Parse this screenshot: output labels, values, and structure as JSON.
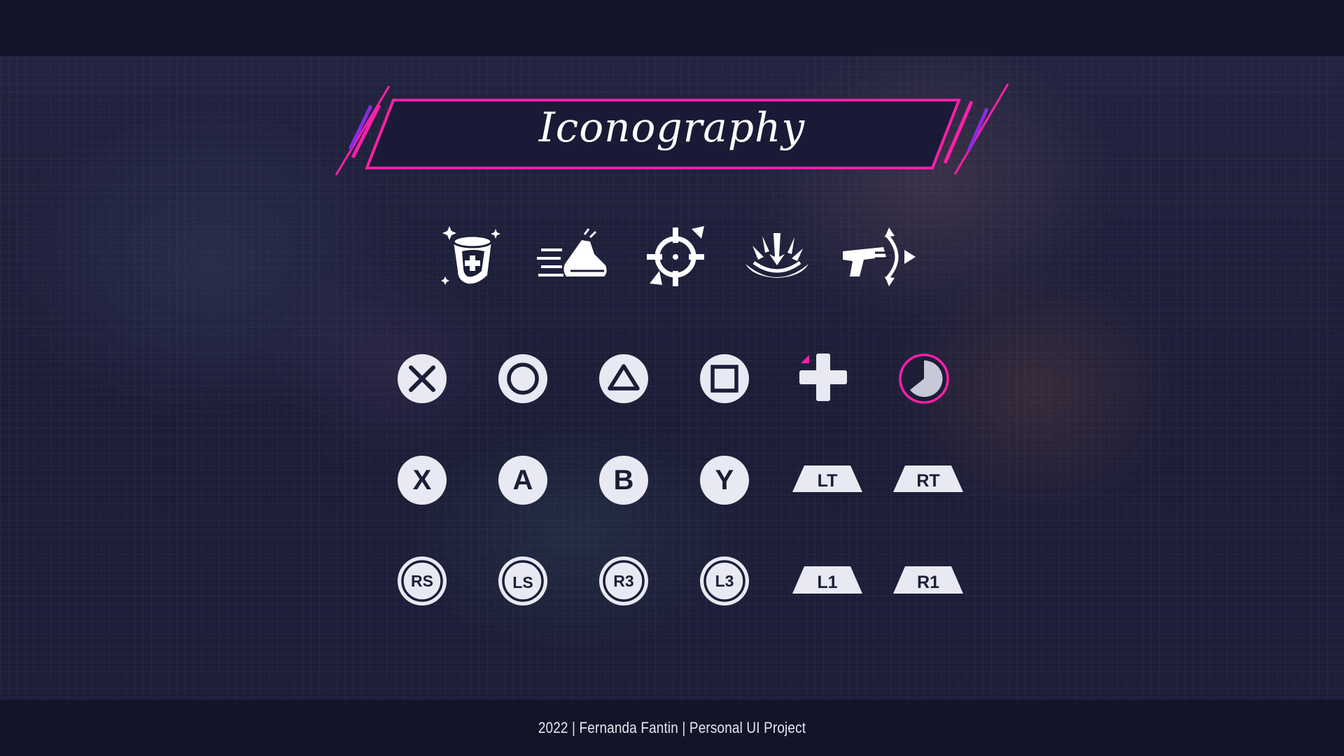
{
  "title": "Iconography",
  "footer": "2022 | Fernanda Fantin | Personal UI Project",
  "colors": {
    "accent": "#ff1fa8",
    "accent_violet": "#8a2be2",
    "background": "#1c1d37",
    "icon_fill": "#e8e9f2",
    "icon_ink": "#1c1d37"
  },
  "feature_icons": [
    "shield-potion-icon",
    "sprint-shoe-icon",
    "crosshair-icon",
    "ground-impact-icon",
    "blaster-dash-icon"
  ],
  "playstation_buttons": [
    "cross-button-icon",
    "circle-button-icon",
    "triangle-button-icon",
    "square-button-icon",
    "dpad-icon",
    "cooldown-timer-icon"
  ],
  "xbox_buttons": {
    "x": "X",
    "a": "A",
    "b": "B",
    "y": "Y",
    "lt": "LT",
    "rt": "RT"
  },
  "stick_buttons": {
    "rs": "RS",
    "ls": "LS",
    "r3": "R3",
    "l3": "L3",
    "l1": "L1",
    "r1": "R1"
  }
}
